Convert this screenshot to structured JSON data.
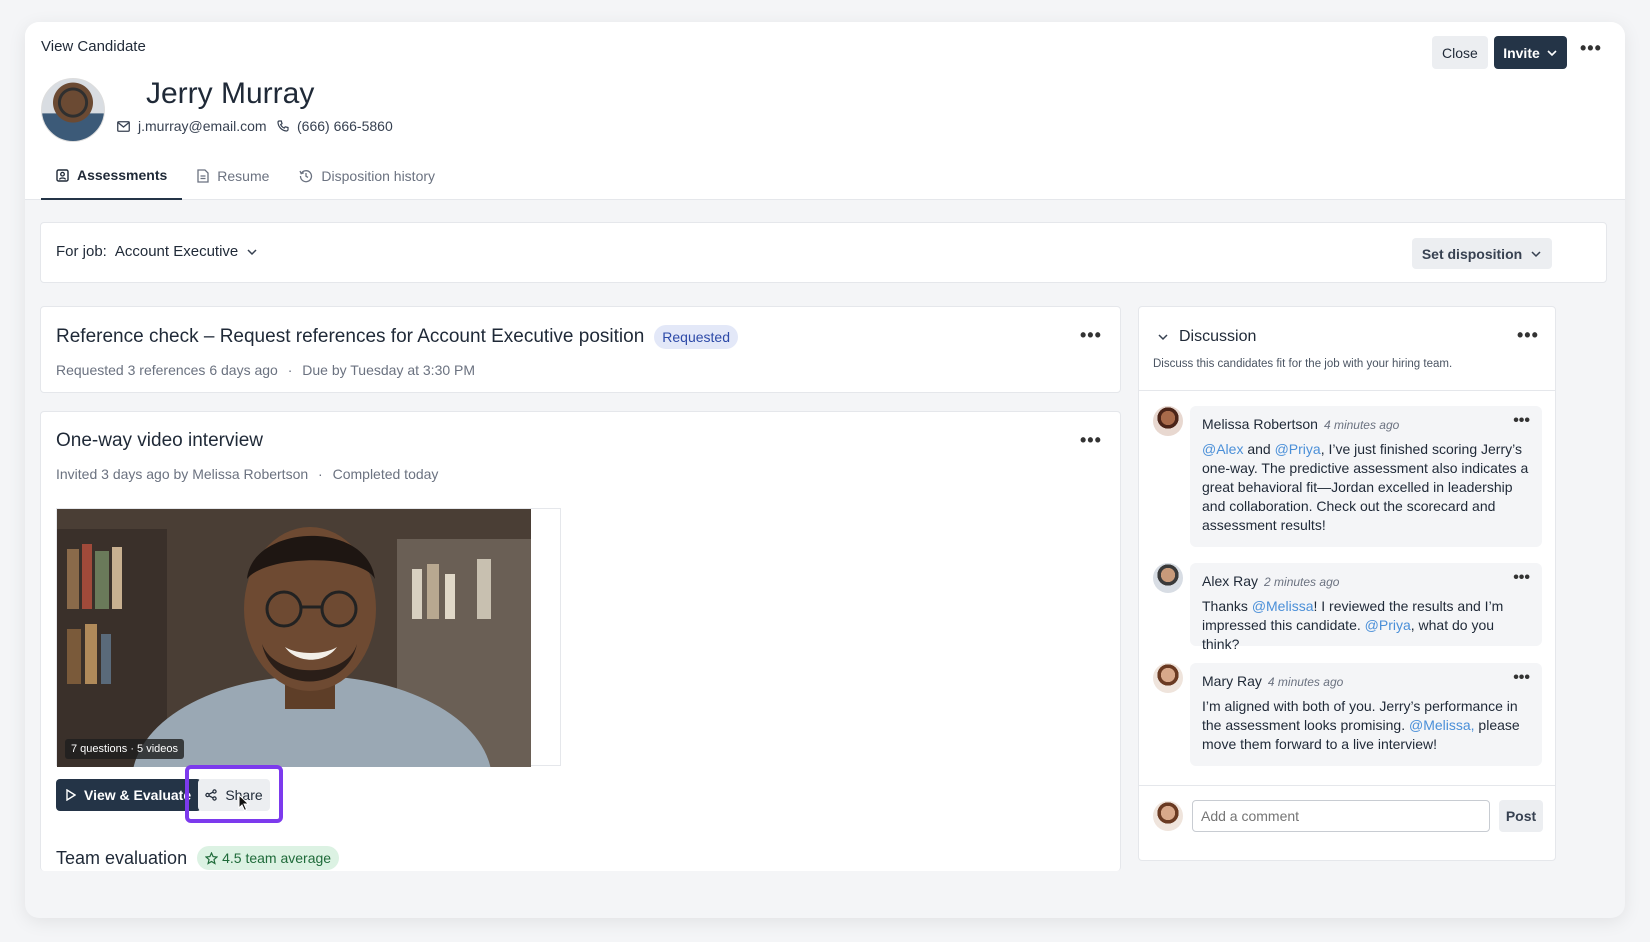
{
  "header": {
    "title": "View Candidate",
    "close_label": "Close",
    "invite_label": "Invite",
    "candidate_name": "Jerry Murray",
    "email": "j.murray@email.com",
    "phone": "(666) 666-5860"
  },
  "tabs": [
    {
      "label": "Assessments",
      "icon": "assessment-icon",
      "active": true
    },
    {
      "label": "Resume",
      "icon": "document-icon",
      "active": false
    },
    {
      "label": "Disposition history",
      "icon": "history-icon",
      "active": false
    }
  ],
  "job_bar": {
    "prefix": "For job:",
    "job": "Account Executive",
    "set_disposition_label": "Set disposition"
  },
  "reference_check": {
    "title": "Reference check – Request references for Account Executive position",
    "status": "Requested",
    "requested_text": "Requested 3 references 6 days ago",
    "due_text": "Due by Tuesday at 3:30 PM"
  },
  "video_interview": {
    "title": "One-way video interview",
    "invited_text": "Invited 3 days ago by Melissa Robertson",
    "completed_text": "Completed today",
    "video_tag": "7 questions · 5 videos",
    "view_label": "View & Evaluate",
    "share_label": "Share",
    "team_eval_label": "Team evaluation",
    "team_average": "4.5 team average"
  },
  "discussion": {
    "title": "Discussion",
    "subtitle": "Discuss this candidates fit for the job with your hiring team.",
    "comments": [
      {
        "name": "Melissa Robertson",
        "time": "4 minutes ago",
        "parts": [
          {
            "t": "@Alex",
            "m": true
          },
          {
            "t": " and ",
            "m": false
          },
          {
            "t": "@Priya",
            "m": true
          },
          {
            "t": ", I’ve just finished scoring Jerry’s one-way. The predictive assessment also indicates a great behavioral fit—Jordan excelled in leadership and collaboration. Check out the scorecard and assessment results!",
            "m": false
          }
        ]
      },
      {
        "name": "Alex Ray",
        "time": "2 minutes ago",
        "parts": [
          {
            "t": "Thanks ",
            "m": false
          },
          {
            "t": "@Melissa",
            "m": true
          },
          {
            "t": "! I reviewed the results and I’m impressed this candidate. ",
            "m": false
          },
          {
            "t": "@Priya",
            "m": true
          },
          {
            "t": ", what do you think?",
            "m": false
          }
        ]
      },
      {
        "name": "Mary Ray",
        "time": "4 minutes ago",
        "parts": [
          {
            "t": "I’m aligned with both of you. Jerry’s performance in the assessment looks promising. ",
            "m": false
          },
          {
            "t": "@Melissa,",
            "m": true
          },
          {
            "t": " please move them forward to a live interview!",
            "m": false
          }
        ]
      }
    ],
    "comment_placeholder": "Add a comment",
    "post_label": "Post"
  }
}
